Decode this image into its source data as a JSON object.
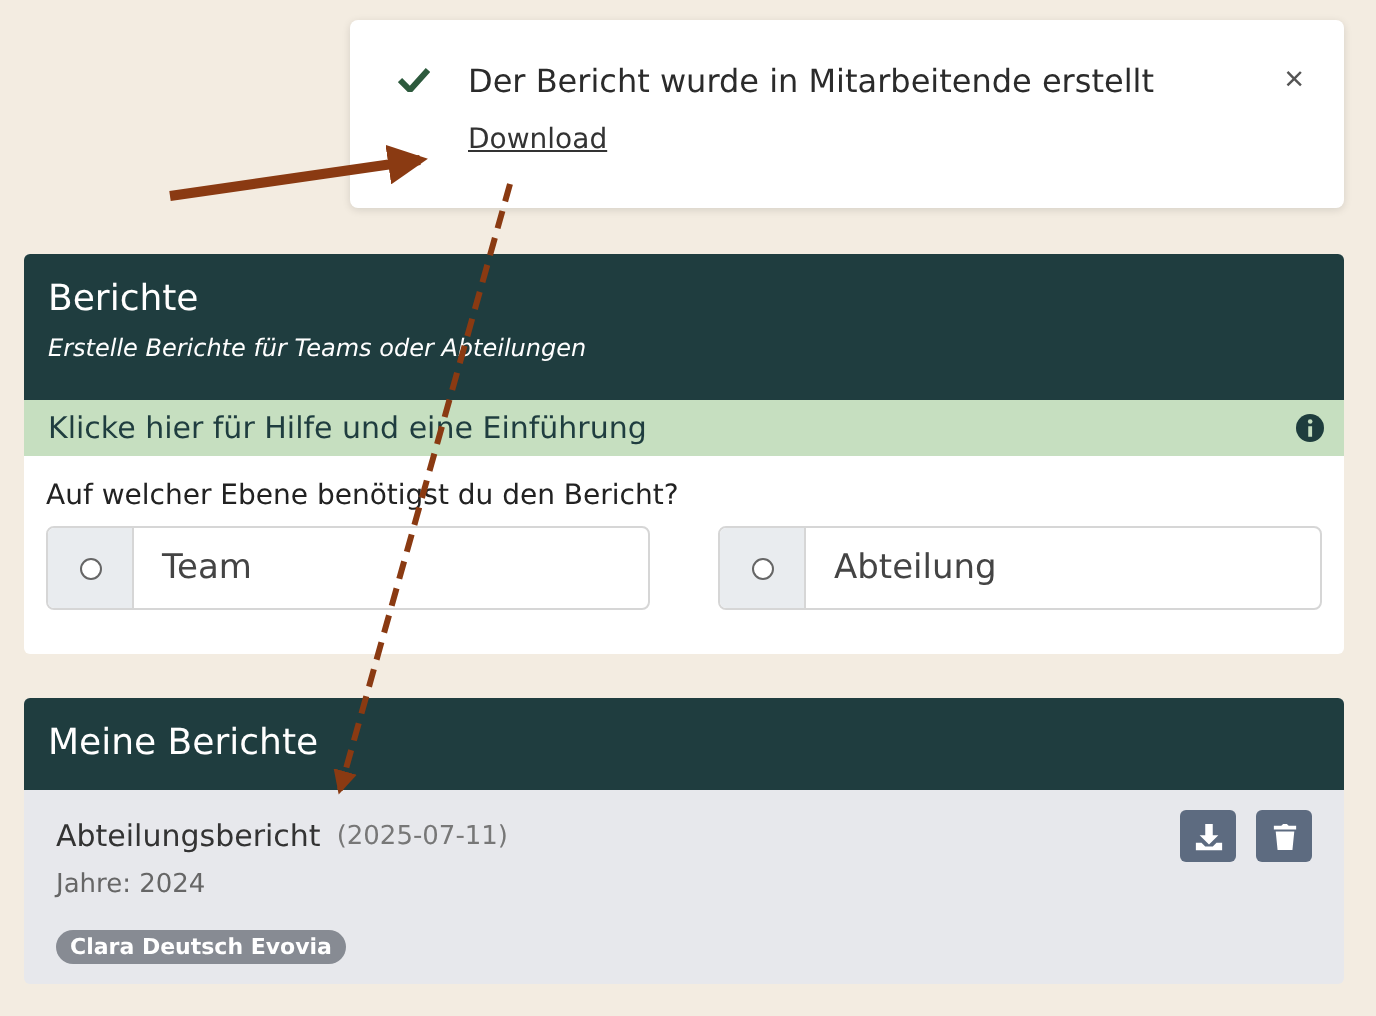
{
  "toast": {
    "message": "Der Bericht wurde in Mitarbeitende erstellt",
    "link": "Download",
    "close": "×"
  },
  "create_panel": {
    "title": "Berichte",
    "subtitle": "Erstelle Berichte für Teams oder Abteilungen",
    "help": "Klicke hier für Hilfe und eine Einführung",
    "question": "Auf welcher Ebene benötigst du den Bericht?",
    "options": [
      {
        "label": "Team",
        "selected": false
      },
      {
        "label": "Abteilung",
        "selected": false
      }
    ]
  },
  "reports_panel": {
    "title": "Meine Berichte",
    "reports": [
      {
        "name": "Abteilungsbericht",
        "date": "(2025-07-11)",
        "years": "Jahre: 2024",
        "tags": [
          "Clara Deutsch Evovia"
        ]
      }
    ]
  }
}
